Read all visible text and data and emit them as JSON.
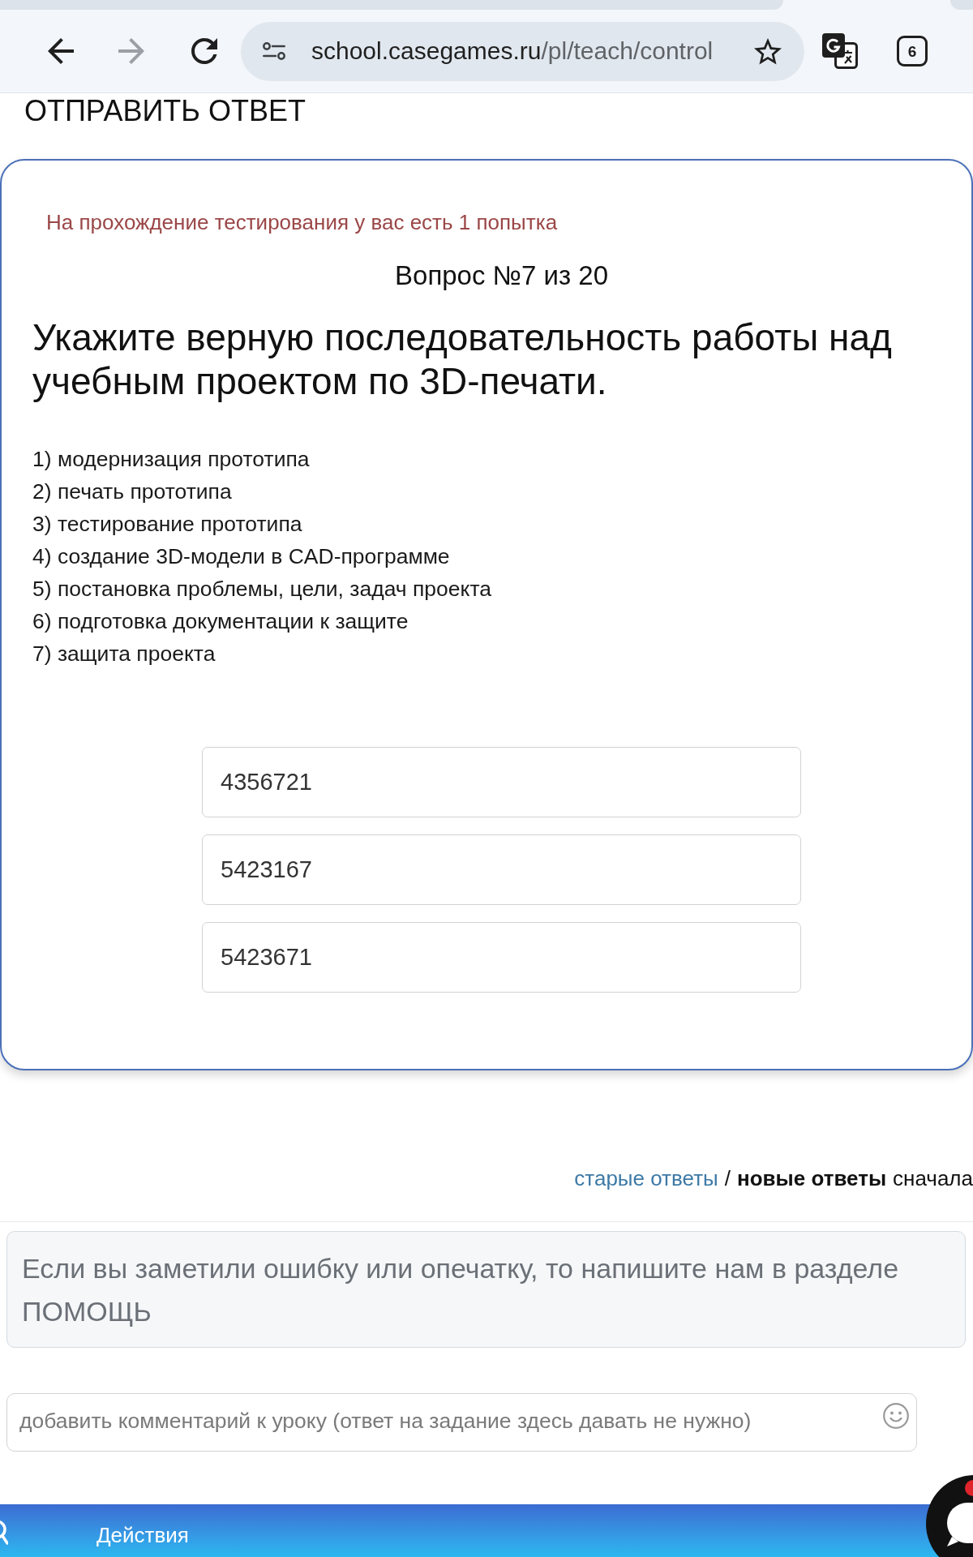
{
  "browser": {
    "nav": [
      {
        "kind": "back",
        "disabled": false
      },
      {
        "kind": "forward",
        "disabled": true
      },
      {
        "kind": "reload",
        "disabled": false
      }
    ],
    "address": {
      "host": "school.casegames.ru",
      "path": "/pl/teach/control"
    },
    "tab_count": "6"
  },
  "page": {
    "submit_label": "ОТПРАВИТЬ ОТВЕТ"
  },
  "quiz": {
    "attempts_note": "На прохождение тестирования у вас есть 1 попытка",
    "counter": "Вопрос №7 из 20",
    "question": "Укажите верную последовательность работы над учебным проектом по 3D-печати.",
    "steps": [
      "1) модернизация прототипа",
      "2) печать прототипа",
      "3) тестирование прототипа",
      "4) создание 3D-модели в CAD-программе",
      "5) постановка проблемы, цели, задач проекта",
      "6) подготовка документации к защите",
      "7) защита проекта"
    ],
    "options": [
      {
        "label": "4356721",
        "selected": false
      },
      {
        "label": "5423167",
        "selected": false
      },
      {
        "label": "5423671",
        "selected": false
      }
    ]
  },
  "sort": {
    "options": [
      {
        "label": "старые ответы",
        "selected": false
      },
      {
        "label": "новые ответы",
        "selected": true
      }
    ],
    "separator": "/",
    "suffix": "сначала"
  },
  "notice": "Если вы заметили ошибку или опечатку, то напишите нам в разделе ПОМОЩЬ",
  "comment": {
    "placeholder": "добавить комментарий к уроку (ответ на задание здесь давать не нужно)"
  },
  "bottom_bar": {
    "label": "Действия"
  }
}
